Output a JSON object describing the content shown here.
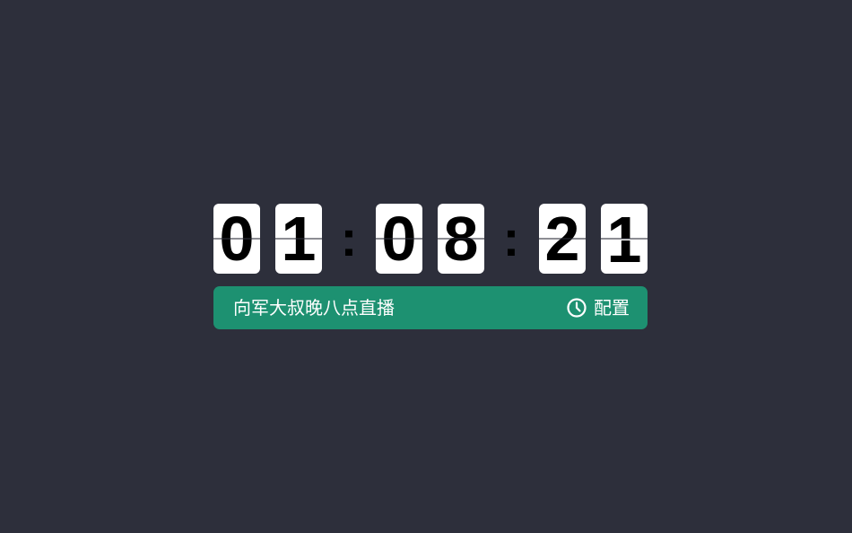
{
  "clock": {
    "hours": [
      "0",
      "1"
    ],
    "minutes": [
      "0",
      "8"
    ],
    "seconds": [
      "2",
      "1"
    ],
    "separator": ":"
  },
  "bar": {
    "title": "向军大叔晚八点直播",
    "config_label": "配置",
    "config_icon": "clock-icon",
    "accent": "#1d9171"
  },
  "colors": {
    "background": "#2d2f3b",
    "card": "#ffffff",
    "digit": "#000000"
  }
}
